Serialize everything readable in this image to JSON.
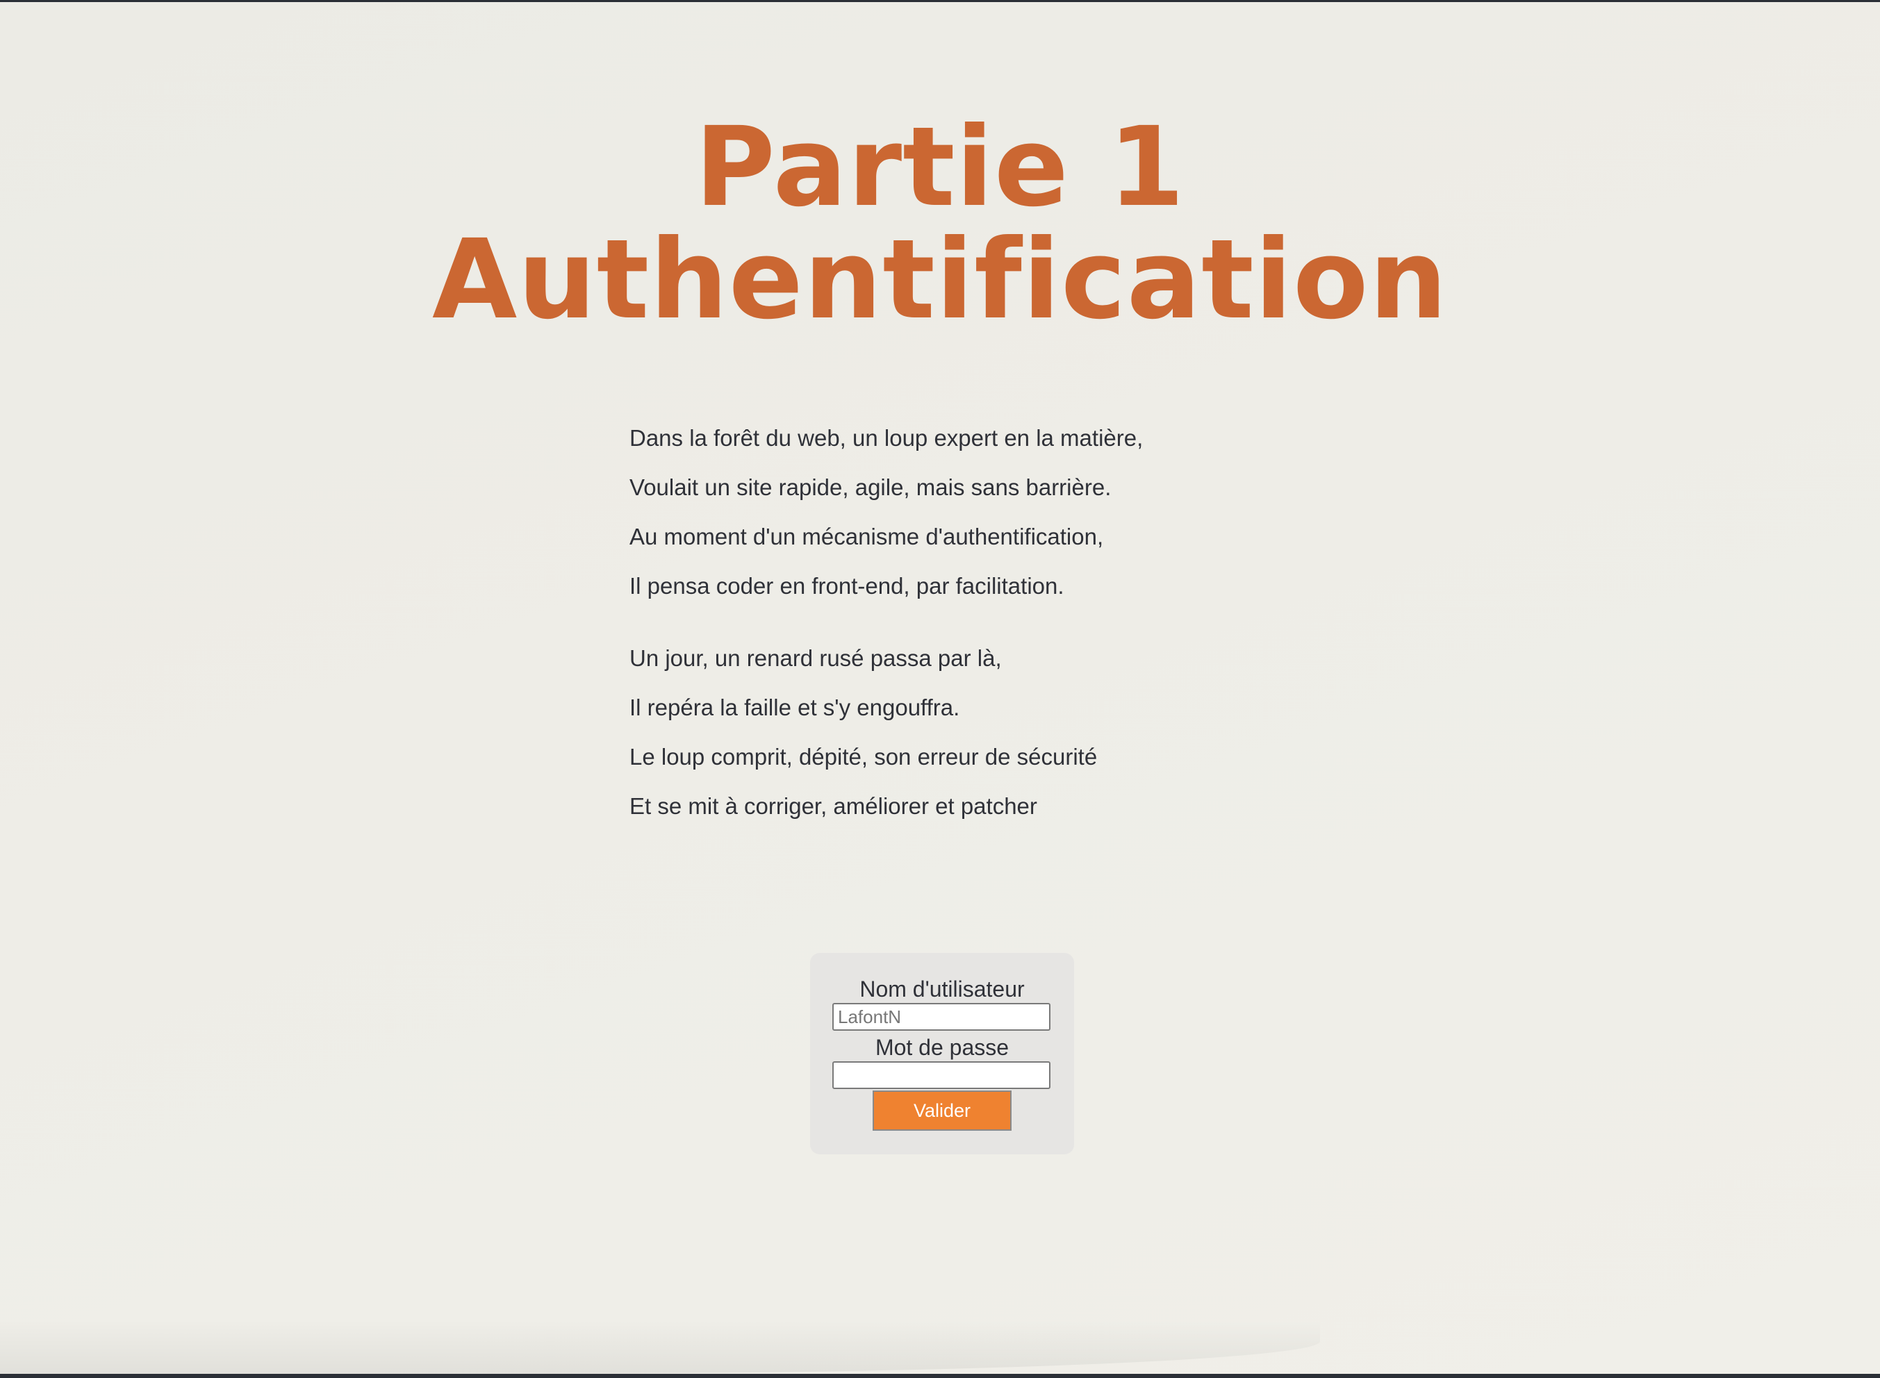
{
  "title": {
    "line1": "Partie 1",
    "line2": "Authentification"
  },
  "poem": {
    "stanzas": [
      [
        "Dans la forêt du web, un loup expert en la matière,",
        "Voulait un site rapide, agile, mais sans barrière.",
        "Au moment d'un mécanisme d'authentification,",
        "Il pensa coder en front-end, par facilitation."
      ],
      [
        "Un jour, un renard rusé passa par là,",
        "Il repéra la faille et s'y engouffra.",
        "Le loup comprit, dépité, son erreur de sécurité",
        "Et se mit à corriger, améliorer et patcher"
      ]
    ]
  },
  "login": {
    "username_label": "Nom d'utilisateur",
    "username_placeholder": "LafontN",
    "username_value": "",
    "password_label": "Mot de passe",
    "password_value": "",
    "submit_label": "Valider"
  },
  "colors": {
    "title": "#cb6732",
    "button": "#ef8230",
    "background": "#eeede7",
    "login_panel": "#e6e5e3"
  }
}
